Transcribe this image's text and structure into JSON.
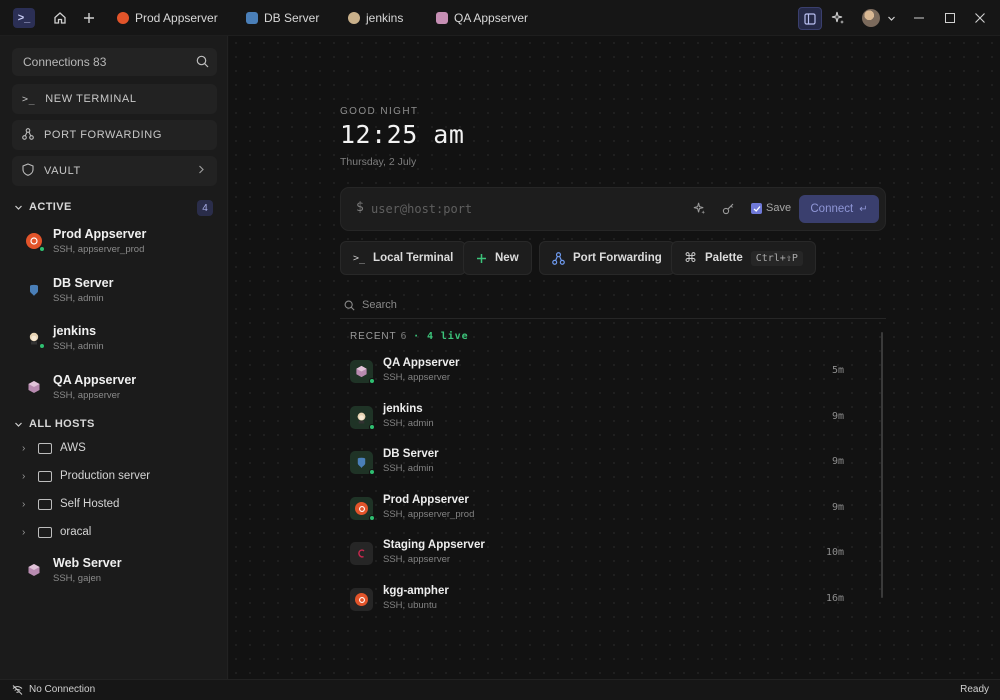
{
  "titlebar": {
    "tabs": [
      {
        "label": "Prod Appserver",
        "icon": "ubuntu-icon",
        "color": "#e2542a"
      },
      {
        "label": "DB Server",
        "icon": "postgres-icon",
        "color": "#4a7fb8"
      },
      {
        "label": "jenkins",
        "icon": "jenkins-icon",
        "color": "#c9b08a"
      },
      {
        "label": "QA Appserver",
        "icon": "host-icon",
        "color": "#c68fb4"
      }
    ]
  },
  "sidebar": {
    "search_placeholder": "Connections 83",
    "buttons": {
      "new_terminal": "NEW TERMINAL",
      "port_forwarding": "PORT FORWARDING",
      "vault": "VAULT"
    },
    "active": {
      "title": "ACTIVE",
      "count": "4",
      "items": [
        {
          "name": "Prod Appserver",
          "sub": "SSH, appserver_prod",
          "icon": "ubuntu-icon",
          "color": "#e2542a"
        },
        {
          "name": "DB Server",
          "sub": "SSH, admin",
          "icon": "postgres-icon",
          "color": "#4a7fb8"
        },
        {
          "name": "jenkins",
          "sub": "SSH, admin",
          "icon": "jenkins-icon",
          "color": "#c9b08a"
        },
        {
          "name": "QA Appserver",
          "sub": "SSH, appserver",
          "icon": "host-icon",
          "color": "#c68fb4"
        }
      ]
    },
    "all_hosts": {
      "title": "ALL HOSTS",
      "folders": [
        "AWS",
        "Production servers",
        "Self Hosted",
        "oracal"
      ],
      "items": [
        {
          "name": "Web Server",
          "sub": "SSH, gajen",
          "icon": "host-icon",
          "color": "#c68fb4"
        }
      ]
    }
  },
  "main": {
    "greeting": "GOOD NIGHT",
    "time": "12:25 am",
    "date": "Thursday, 2 July",
    "connect": {
      "prompt": "$",
      "placeholder": "user@host:port",
      "save_label": "Save",
      "save_checked": true,
      "connect_label": "Connect"
    },
    "quick_actions": {
      "local_terminal": "Local Terminal",
      "new": "New",
      "port_forwarding": "Port Forwarding",
      "palette": "Palette",
      "palette_shortcut": "Ctrl+⇧P"
    },
    "list_search_placeholder": "Search",
    "recent": {
      "title": "RECENT",
      "count": "6",
      "live": "· 4 live",
      "items": [
        {
          "name": "QA Appserver",
          "sub": "SSH, appserver",
          "time": "5m",
          "live": true,
          "icon": "host-icon",
          "color": "#c68fb4"
        },
        {
          "name": "jenkins",
          "sub": "SSH, admin",
          "time": "9m",
          "live": true,
          "icon": "jenkins-icon",
          "color": "#c9b08a"
        },
        {
          "name": "DB Server",
          "sub": "SSH, admin",
          "time": "9m",
          "live": true,
          "icon": "postgres-icon",
          "color": "#4a7fb8"
        },
        {
          "name": "Prod Appserver",
          "sub": "SSH, appserver_prod",
          "time": "9m",
          "live": true,
          "icon": "ubuntu-icon",
          "color": "#e2542a"
        },
        {
          "name": "Staging Appserver",
          "sub": "SSH, appserver",
          "time": "10m",
          "live": false,
          "icon": "debian-icon",
          "color": "#c8284e"
        },
        {
          "name": "kgg-ampher",
          "sub": "SSH, ubuntu",
          "time": "16m",
          "live": false,
          "icon": "ubuntu-icon",
          "color": "#e2542a"
        }
      ]
    }
  },
  "statusbar": {
    "connection": "No Connection",
    "state": "Ready"
  },
  "colors": {
    "accent": "#6f79d8",
    "live": "#2fbf71",
    "background": "#121212",
    "sidebar": "#1b1b1b"
  }
}
